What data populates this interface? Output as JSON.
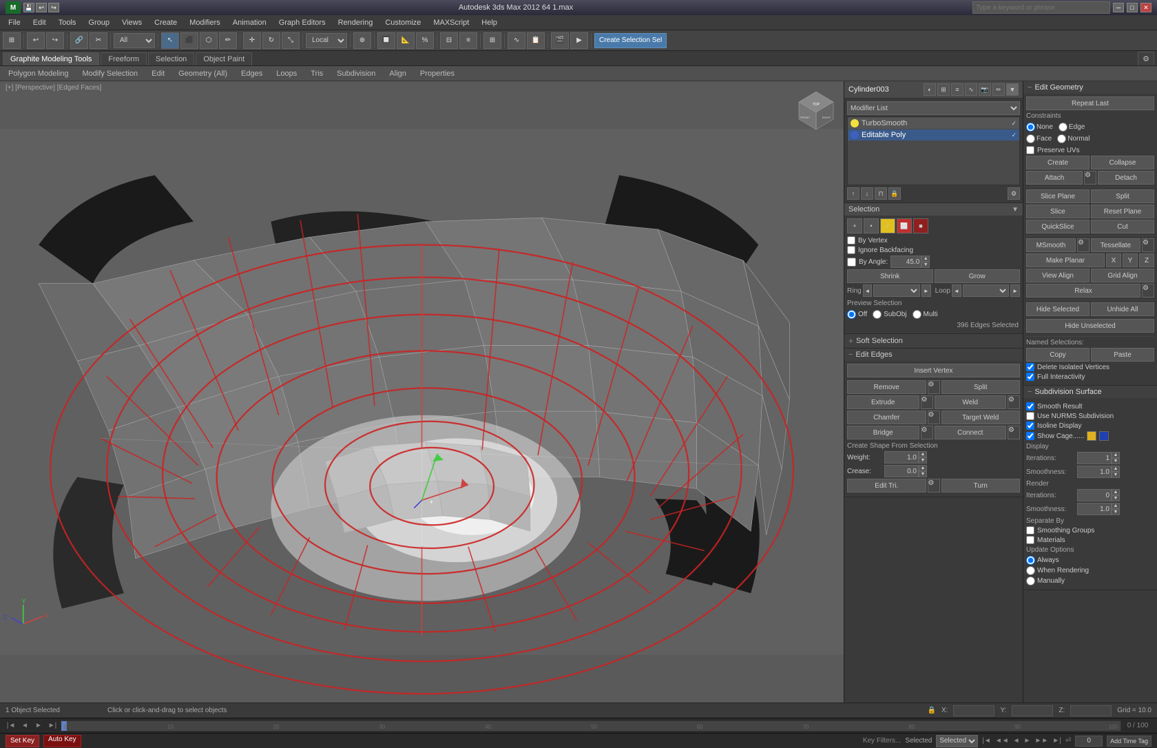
{
  "app": {
    "title": "Autodesk 3ds Max 2012 64    1.max",
    "logo": "M"
  },
  "titlebar": {
    "minimize": "─",
    "maximize": "□",
    "close": "✕",
    "search_placeholder": "Type a keyword or phrase"
  },
  "menubar": {
    "items": [
      "File",
      "Edit",
      "Tools",
      "Group",
      "Views",
      "Create",
      "Modifiers",
      "Animation",
      "Graph Editors",
      "Rendering",
      "Customize",
      "MAXScript",
      "Help"
    ]
  },
  "ribbon": {
    "tabs": [
      "Graphite Modeling Tools",
      "Freeform",
      "Selection",
      "Object Paint"
    ],
    "active_tab": "Graphite Modeling Tools",
    "subtabs": [
      "Polygon Modeling",
      "Modify Selection",
      "Edit",
      "Geometry (All)",
      "Edges",
      "Loops",
      "Tris",
      "Subdivision",
      "Align",
      "Properties"
    ]
  },
  "viewport": {
    "label": "[+] [Perspective] [Edged Faces]",
    "object_name": "Cylinder003"
  },
  "right_panel": {
    "object_name": "Cylinder003",
    "modifier_list_label": "Modifier List",
    "modifiers": [
      {
        "name": "TurboSmooth",
        "active": false
      },
      {
        "name": "Editable Poly",
        "active": true
      }
    ],
    "top_icons": [
      "pin",
      "lock",
      "list",
      "graph",
      "camera",
      "edit",
      "more"
    ],
    "selection_section": {
      "title": "Selection",
      "sel_icons": [
        "+",
        "vertex",
        "edge",
        "border",
        "poly"
      ],
      "by_vertex": "By Vertex",
      "ignore_backfacing": "Ignore Backfacing",
      "by_angle_label": "By Angle:",
      "by_angle_value": "45.0",
      "shrink": "Shrink",
      "grow": "Grow",
      "ring": "Ring",
      "loop": "Loop",
      "preview_label": "Preview Selection",
      "off": "Off",
      "subobj": "SubObj",
      "multi": "Multi",
      "status": "396 Edges Selected"
    },
    "soft_selection": {
      "title": "Soft Selection",
      "plus": "+"
    },
    "edit_edges": {
      "title": "Edit Edges",
      "insert_vertex": "Insert Vertex",
      "remove": "Remove",
      "split": "Split",
      "extrude": "Extrude",
      "weld": "Weld",
      "chamfer": "Chamfer",
      "target_weld": "Target Weld",
      "bridge": "Bridge",
      "connect": "Connect",
      "create_shape_label": "Create Shape From Selection",
      "weight_label": "Weight:",
      "weight_value": "1.0",
      "crease_label": "Crease:",
      "crease_value": "0.0",
      "edit_tri": "Edit Tri.",
      "turn": "Turn"
    },
    "edit_geometry": {
      "title": "Edit Geometry",
      "repeat_last": "Repeat Last",
      "constraints_label": "Constraints",
      "none": "None",
      "edge": "Edge",
      "face": "Face",
      "normal": "Normal",
      "preserve_uvs": "Preserve UVs",
      "create": "Create",
      "collapse": "Collapse",
      "attach": "Attach",
      "detach": "Detach",
      "slice_plane": "Slice Plane",
      "split": "Split",
      "slice": "Slice",
      "reset_plane": "Reset Plane",
      "quickslice": "QuickSlice",
      "cut": "Cut",
      "msmooth": "MSmooth",
      "tessellate": "Tessellate",
      "make_planar": "Make Planar",
      "x": "X",
      "y": "Y",
      "z": "Z",
      "view_align": "View Align",
      "grid_align": "Grid Align",
      "relax": "Relax",
      "hide_selected": "Hide Selected",
      "unhide_all": "Unhide All",
      "hide_unselected": "Hide Unselected",
      "named_sel_label": "Named Selections:",
      "copy": "Copy",
      "paste": "Paste",
      "delete_isolated": "Delete Isolated Vertices",
      "full_interactivity": "Full Interactivity"
    },
    "subdivision": {
      "title": "Subdivision Surface",
      "smooth_result": "Smooth Result",
      "use_nurms": "Use NURMS Subdivision",
      "isoline_display": "Isoline Display",
      "show_cage": "Show Cage......",
      "display_label": "Display",
      "iterations_label": "Iterations:",
      "iterations_value": "1",
      "smoothness_label": "Smoothness:",
      "smoothness_value": "1.0",
      "render_label": "Render",
      "render_iterations_value": "0",
      "render_smoothness_value": "1.0",
      "separate_by_label": "Separate By",
      "smoothing_groups": "Smoothing Groups",
      "materials": "Materials",
      "update_options_label": "Update Options",
      "always": "Always",
      "when_rendering": "When Rendering",
      "manually": "Manually"
    }
  },
  "statusbar": {
    "objects": "1 Object Selected",
    "hint": "Click or click-and-drag to select objects",
    "x_label": "X:",
    "y_label": "Y:",
    "z_label": "Z:",
    "grid_label": "Grid = 10.0",
    "addtimetag": "Add Time Tag",
    "selected_label": "Selected",
    "autokey": "Auto Key"
  },
  "timeline": {
    "current": "0 / 100"
  },
  "toolbar_create": "Create Selection Sel",
  "colors": {
    "accent_blue": "#3a5a8a",
    "edge_red": "#cc2222",
    "selected_yellow": "#e0c020",
    "bg_dark": "#3a3a3a",
    "bg_medium": "#4a4a4a",
    "bg_light": "#555555"
  }
}
